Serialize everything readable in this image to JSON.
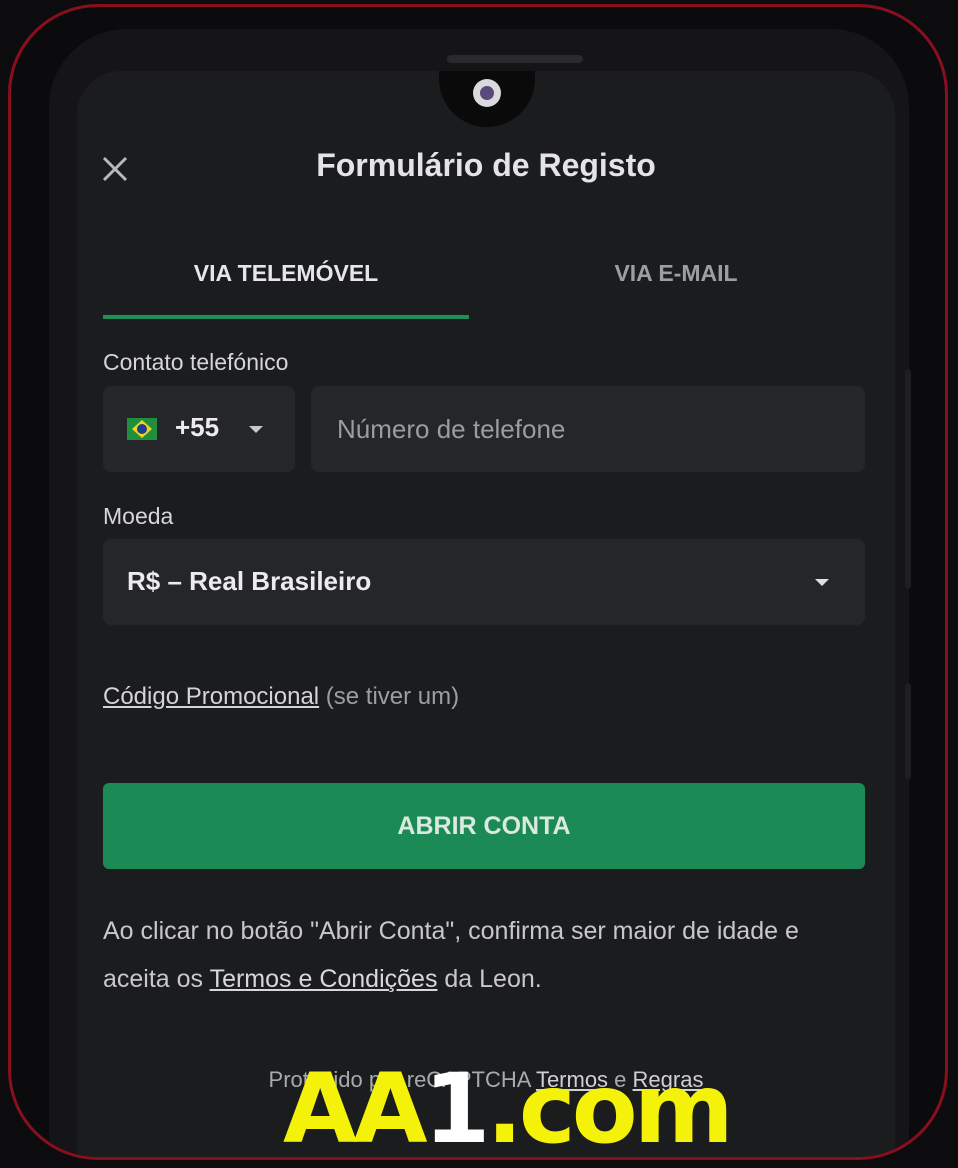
{
  "header": {
    "title": "Formulário de Registo"
  },
  "tabs": [
    {
      "label": "VIA TELEMÓVEL",
      "active": true
    },
    {
      "label": "VIA E-MAIL",
      "active": false
    }
  ],
  "phone": {
    "label": "Contato telefónico",
    "dial_code": "+55",
    "flag": "brazil-flag-icon",
    "placeholder": "Número de telefone"
  },
  "currency": {
    "label": "Moeda",
    "value": "R$ – Real Brasileiro"
  },
  "promo": {
    "link": "Código Promocional",
    "suffix": " (se tiver um)"
  },
  "cta": {
    "label": "ABRIR CONTA"
  },
  "terms": {
    "prefix": "Ao clicar no botão \"Abrir Conta\", confirma ser maior de idade e aceita os ",
    "link": "Termos e Condições",
    "suffix": " da Leon."
  },
  "recaptcha": {
    "prefix": "Protegido por reCAPTCHA ",
    "terms": "Termos",
    "and": " e ",
    "rules": "Regras"
  },
  "watermark": {
    "part1": "AA",
    "part2": "1",
    "part3": ".com"
  },
  "colors": {
    "accent": "#1c8a54",
    "frame": "#8a0f1e",
    "watermark": "#f5f20a"
  }
}
